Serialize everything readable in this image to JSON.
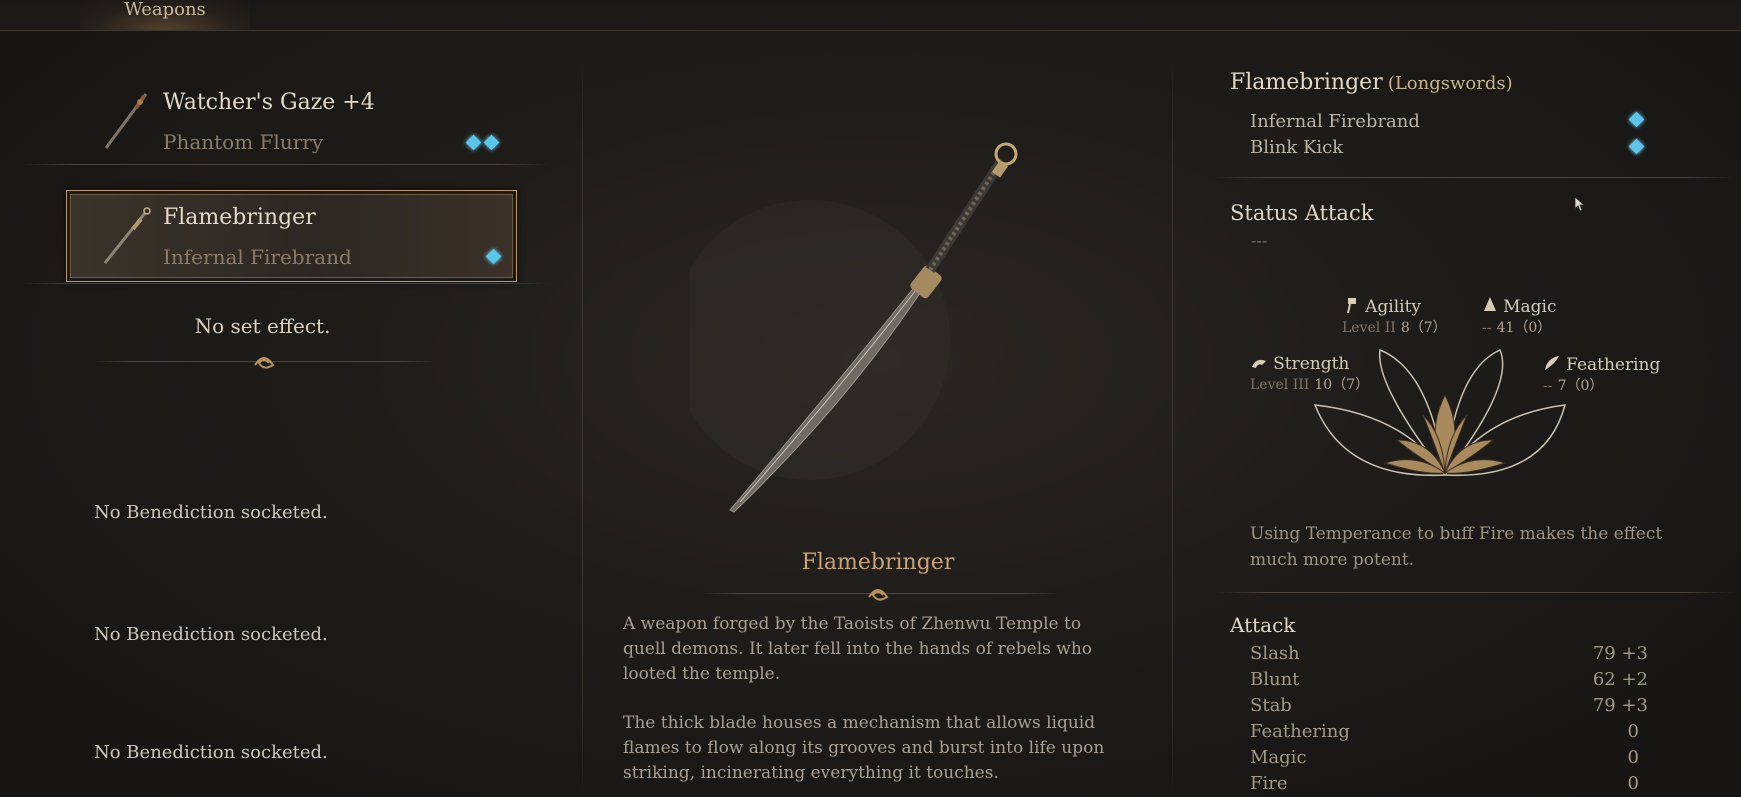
{
  "tabs": {
    "active": "Weapons"
  },
  "weapon_list": [
    {
      "name": "Watcher's Gaze +4",
      "skill": "Phantom Flurry",
      "gems": 2,
      "selected": false
    },
    {
      "name": "Flamebringer",
      "skill": "Infernal Firebrand",
      "gems": 1,
      "selected": true
    }
  ],
  "set_effect": "No set effect.",
  "benedictions": [
    "No Benediction socketed.",
    "No Benediction socketed.",
    "No Benediction socketed."
  ],
  "center": {
    "title": "Flamebringer",
    "desc1": "A weapon forged by the Taoists of Zhenwu Temple to quell demons. It later fell into the hands of rebels who looted the temple.",
    "desc2": "The thick blade houses a mechanism that allows liquid flames to flow along its grooves and burst into life upon striking, incinerating everything it touches."
  },
  "details": {
    "name": "Flamebringer",
    "type": "(Longswords)",
    "skills": [
      "Infernal Firebrand",
      "Blink Kick"
    ],
    "status_attack_title": "Status Attack",
    "status_attack_value": "---",
    "stats": {
      "agility": {
        "name": "Agility",
        "level": "Level II",
        "value": "8（7）"
      },
      "magic": {
        "name": "Magic",
        "level": "--",
        "value": "41（0）"
      },
      "strength": {
        "name": "Strength",
        "level": "Level III",
        "value": "10（7）"
      },
      "feathering": {
        "name": "Feathering",
        "level": "--",
        "value": "7（0）"
      }
    },
    "tip": "Using Temperance to buff Fire makes the effect much more potent.",
    "attack_title": "Attack",
    "attack": [
      {
        "label": "Slash",
        "value": "79 +3"
      },
      {
        "label": "Blunt",
        "value": "62 +2"
      },
      {
        "label": "Stab",
        "value": "79 +3"
      },
      {
        "label": "Feathering",
        "value": "0"
      },
      {
        "label": "Magic",
        "value": "0"
      },
      {
        "label": "Fire",
        "value": "0"
      }
    ]
  },
  "colors": {
    "gem": "#5cc6ea",
    "accent": "#c9a27a",
    "frame": "#b79a72"
  }
}
